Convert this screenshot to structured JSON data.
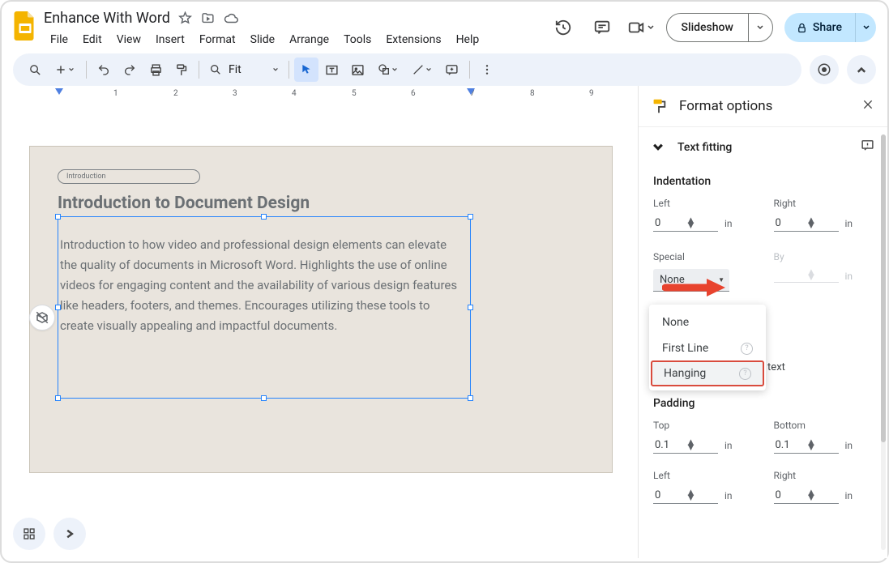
{
  "doc": {
    "title": "Enhance With Word"
  },
  "menus": [
    "File",
    "Edit",
    "View",
    "Insert",
    "Format",
    "Slide",
    "Arrange",
    "Tools",
    "Extensions",
    "Help"
  ],
  "titlebar": {
    "slideshow": "Slideshow",
    "share": "Share"
  },
  "toolbar": {
    "zoom": "Fit"
  },
  "slide": {
    "badge": "Introduction",
    "heading": "Introduction to Document Design",
    "body": "Introduction to how video and professional design elements can elevate the quality of documents in Microsoft Word. Highlights the use of online videos for engaging content and the availability of various design features like headers, footers, and themes. Encourages utilizing these tools to create visually appealing and impactful documents."
  },
  "panel": {
    "title": "Format options",
    "section": "Text fitting",
    "indentation": {
      "heading": "Indentation",
      "left_label": "Left",
      "left_value": "0",
      "right_label": "Right",
      "right_value": "0",
      "special_label": "Special",
      "special_value": "None",
      "by_label": "By",
      "unit": "in"
    },
    "autofit_resize": "Resize shape to fit text",
    "padding": {
      "heading": "Padding",
      "top_label": "Top",
      "top_value": "0.1",
      "bottom_label": "Bottom",
      "bottom_value": "0.1",
      "left_label": "Left",
      "left_value": "0",
      "right_label": "Right",
      "right_value": "0",
      "unit": "in"
    }
  },
  "dropdown": {
    "items": [
      "None",
      "First Line",
      "Hanging"
    ]
  },
  "ruler_numbers": [
    "1",
    "2",
    "3",
    "4",
    "5",
    "6",
    "7",
    "8",
    "9"
  ]
}
